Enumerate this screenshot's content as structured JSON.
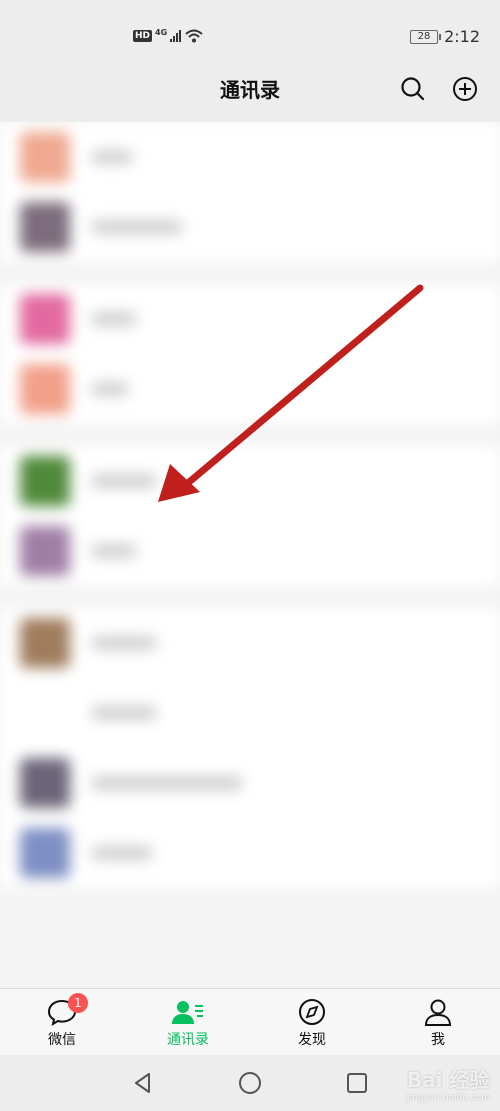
{
  "status_bar": {
    "left_badges": [
      "HD",
      "4G"
    ],
    "battery": "28",
    "time": "2:12"
  },
  "header": {
    "title": "通讯录",
    "search_icon": "search-icon",
    "add_icon": "plus-circle-icon"
  },
  "contacts": {
    "sections": [
      [
        {
          "avatar_color": "#f0a990",
          "name_width": 40
        },
        {
          "avatar_color": "#7d6d7c",
          "name_width": 90
        }
      ],
      [
        {
          "avatar_color": "#e36aa0",
          "name_width": 44
        },
        {
          "avatar_color": "#f2a08a",
          "name_width": 36
        }
      ],
      [
        {
          "avatar_color": "#4f8a3a",
          "name_width": 64
        },
        {
          "avatar_color": "#a07fa6",
          "name_width": 44
        }
      ],
      [
        {
          "avatar_color": "#a07c5d",
          "name_width": 64
        },
        {
          "avatar_color": "#ffffff",
          "name_width": 64
        },
        {
          "avatar_color": "#6b6579",
          "name_width": 150
        },
        {
          "avatar_color": "#7d8fc4",
          "name_width": 60
        }
      ]
    ]
  },
  "tab_bar": {
    "tabs": [
      {
        "label": "微信",
        "icon": "chat-bubble-icon",
        "badge": "1",
        "active": false
      },
      {
        "label": "通讯录",
        "icon": "contacts-icon",
        "active": true
      },
      {
        "label": "发现",
        "icon": "compass-icon",
        "active": false
      },
      {
        "label": "我",
        "icon": "person-icon",
        "active": false
      }
    ]
  },
  "system_nav": {
    "buttons": [
      "back-icon",
      "home-icon",
      "recents-icon"
    ]
  },
  "watermark": {
    "brand": "Bai 经验",
    "url": "jingyan.baidu.com"
  },
  "colors": {
    "accent": "#07c160",
    "badge": "#fa5151",
    "arrow": "#c0201c",
    "background": "#ededed"
  }
}
